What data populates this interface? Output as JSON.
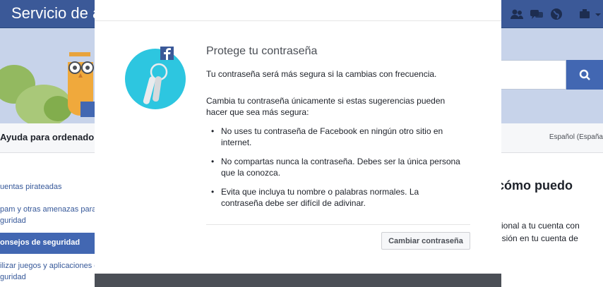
{
  "background": {
    "brand": "Servicio de a",
    "help_title": "Ayuda para ordenado",
    "language": "Español (España",
    "sidebar": [
      "uentas pirateadas",
      "pam y otras amenazas para l",
      "guridad",
      "onsejos de seguridad",
      "ilizar juegos y aplicaciones co",
      "guridad"
    ],
    "article": {
      "title": "cómo puedo",
      "line1": "cional a tu cuenta con",
      "line2": "esión en tu cuenta de"
    },
    "icons": [
      "friends-icon",
      "messages-icon",
      "globe-icon",
      "settings-icon",
      "chevron-down-icon",
      "search-icon"
    ],
    "colors": {
      "brand_blue": "#3b5998",
      "accent_blue": "#4267b2"
    }
  },
  "dialog": {
    "title": "Protege tu contraseña",
    "para1": "Tu contraseña será más segura si la cambias con frecuencia.",
    "para2": "Cambia tu contraseña únicamente si estas sugerencias pueden hacer que sea más segura:",
    "tips": [
      "No uses tu contraseña de Facebook en ningún otro sitio en internet.",
      "No compartas nunca la contraseña. Debes ser la única persona que la conozca.",
      "Evita que incluya tu nombre o palabras normales. La contraseña debe ser difícil de adivinar."
    ],
    "button_label": "Cambiar contraseña",
    "illustration": {
      "icons": [
        "keys-icon",
        "facebook-icon"
      ],
      "circle_color": "#2dc6e0"
    }
  }
}
